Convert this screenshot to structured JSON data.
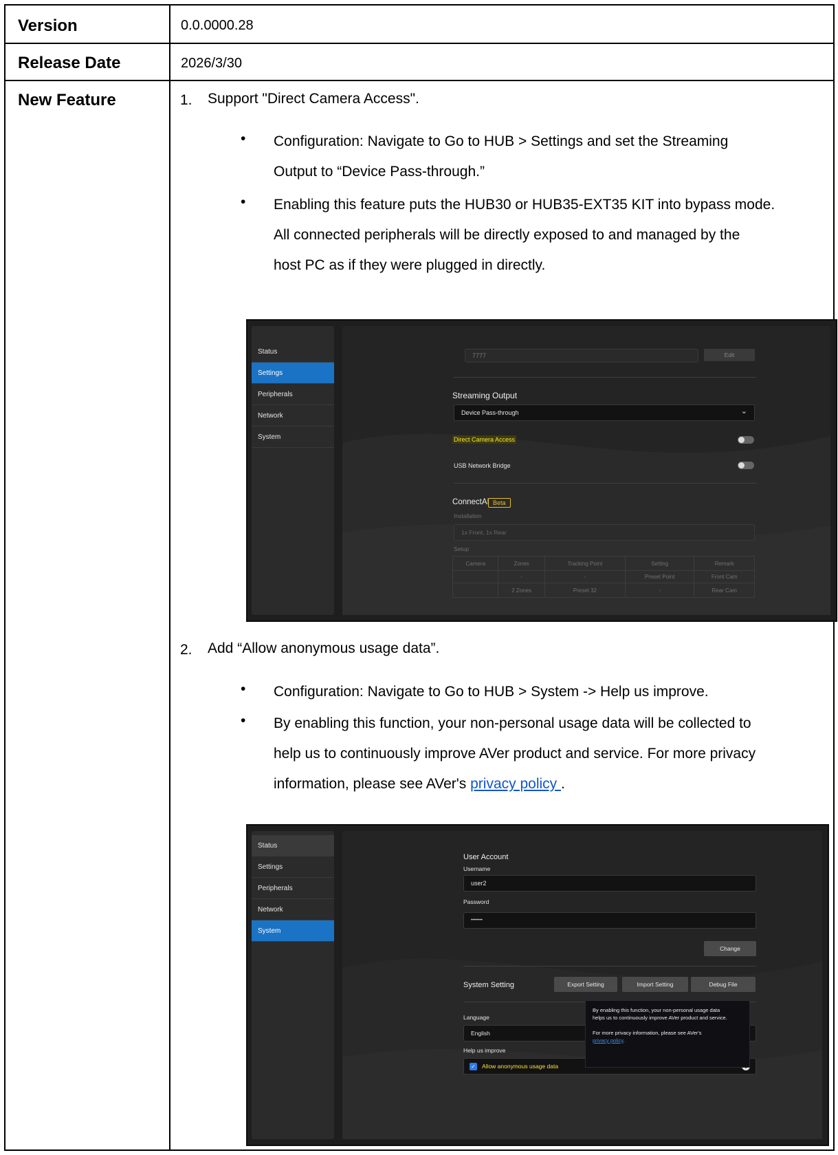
{
  "rows": {
    "version": {
      "label": "Version",
      "value": "0.0.0000.28"
    },
    "release_date": {
      "label": "Release Date",
      "value": "2026/3/30"
    },
    "new_feature": {
      "label": "New Feature"
    }
  },
  "features": [
    {
      "number": "1.",
      "title": "Support \"Direct Camera Access\".",
      "bullets": [
        [
          "Configuration: Navigate to Go to HUB > Settings and set the Streaming",
          "Output to “Device Pass-through.”"
        ],
        [
          "Enabling this feature puts the HUB30 or HUB35-EXT35 KIT into bypass mode.",
          "All connected peripherals will be directly exposed to and managed by the",
          "host PC as if they were plugged in directly."
        ]
      ]
    },
    {
      "number": "2.",
      "title": "Add “Allow anonymous usage data”.",
      "bullets": [
        [
          "Configuration: Navigate to Go to HUB > System -> Help us improve."
        ],
        [
          "By enabling this function, your non-personal usage data will be collected to",
          "help us to continuously improve AVer product and service. For more privacy"
        ]
      ],
      "last_line_prefix": "information, please see AVer's ",
      "last_line_link": "privacy policy ",
      "last_line_suffix": "."
    }
  ],
  "bullet_glyph": "•",
  "shot1": {
    "sidebar": [
      "Status",
      "Settings",
      "Peripherals",
      "Network",
      "System"
    ],
    "active_index": 1,
    "top_input": "7777",
    "edit_button": "Edit",
    "streaming_output_title": "Streaming Output",
    "streaming_output_value": "Device Pass-through",
    "chevron": "⌄",
    "direct_camera_access": "Direct Camera Access",
    "direct_camera_access_on": false,
    "usb_network_bridge": "USB Network Bridge",
    "usb_network_bridge_on": false,
    "connectai": "ConnectAI",
    "beta": "Beta",
    "installation_label": "Installation",
    "installation_value": "1x Front, 1x Rear",
    "setup_label": "Setup",
    "table_headers": [
      "Camera",
      "Zones",
      "Tracking Point",
      "Setting",
      "Remark"
    ],
    "table_rows": [
      [
        "",
        "-",
        "-",
        "Preset Point",
        "Front Cam"
      ],
      [
        "",
        "2 Zones",
        "Preset 32",
        "-",
        "Rear Cam"
      ]
    ]
  },
  "shot2": {
    "sidebar": [
      "Status",
      "Settings",
      "Peripherals",
      "Network",
      "System"
    ],
    "active_index": 4,
    "user_account": "User Account",
    "username_label": "Username",
    "username_value": "user2",
    "password_label": "Password",
    "password_value": "••••••••",
    "change_button": "Change",
    "system_setting": "System Setting",
    "export_button": "Export Setting",
    "import_button": "Import Setting",
    "debug_button": "Debug File",
    "language_label": "Language",
    "language_value": "English",
    "help_label": "Help us improve",
    "allow_checkbox_label": "Allow anonymous usage data",
    "allow_checked": true,
    "check_glyph": "✓",
    "info_glyph": "i",
    "tooltip_line1": "By enabling this function, your non-personal usage data",
    "tooltip_line2": "helps us to continuously improve AVer product and service.",
    "tooltip_line3": "For more privacy information, please see AVer's",
    "tooltip_link": "privacy policy",
    "tooltip_end": "."
  }
}
